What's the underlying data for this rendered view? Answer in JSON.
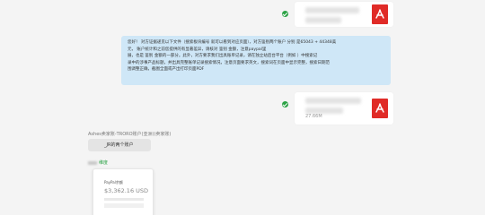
{
  "files": [
    {
      "size": ""
    },
    {
      "size": "27.66M"
    }
  ],
  "message": {
    "lines": [
      "您好！ 对方证据递见以下文件（搜索板块编号 就可以看到对应页面），对方鉴别两个账户 分别 是65043 + 44348美",
      "元，        账户统计和之前您提供的有显著差异，请核对 鉴别 金额，注意paypal里                                           ",
      "展，也是 鉴别 金额的一部分。此外，对方要求我们出具账单记录，请在独立站后台平台（例如        ）中搜索记",
      "录中的涉事产品标题，并出具完整账单记录搜索情况，注意页面要求英文，搜索词在页面中显示完整，搜索日期范",
      "围调整正确，截图全面或产出打印页面PDF"
    ]
  },
  "group_label": "Ashes卖家账-TRORO账户(亚洲)(卖家账)",
  "reply": {
    "text": "_JR的两个账户"
  },
  "sender": {
    "name": "维度"
  },
  "wallet": {
    "name": "PayPal余额",
    "amount": "$3,362.16 USD"
  },
  "colors": {
    "pdf": "#e02b27",
    "bubble_blue": "#cfe7f7",
    "check": "#2ba245"
  },
  "icons": {
    "file": "pdf-icon",
    "status": "sent-check-icon"
  }
}
